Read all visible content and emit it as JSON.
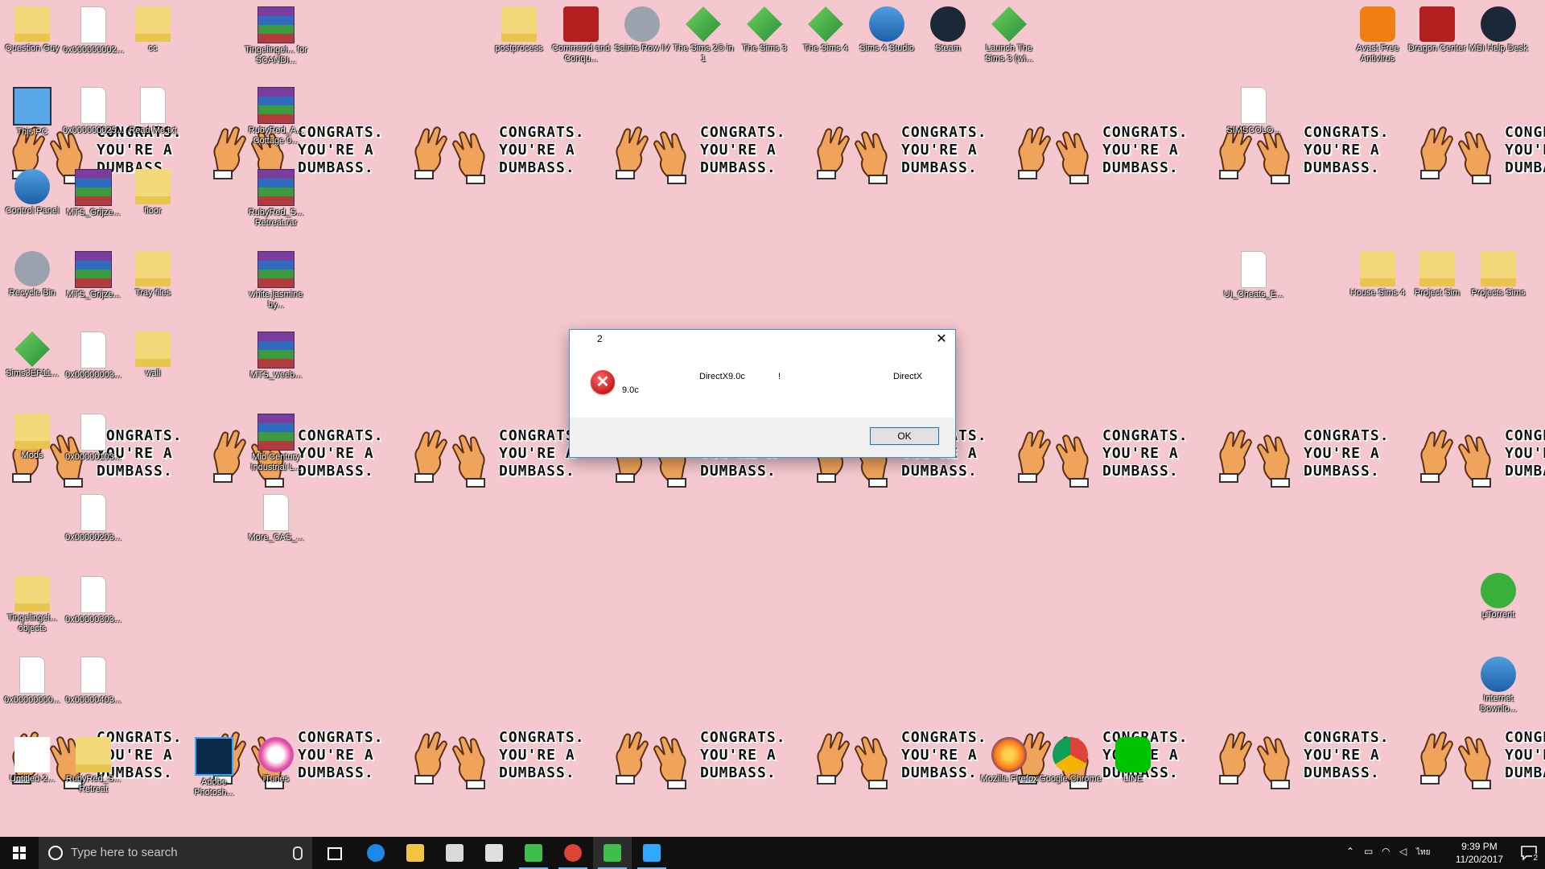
{
  "wallpaper": {
    "tile_text": "CONGRATS.\nYOU'RE A\nDUMBASS.",
    "background": "#f4c8ce"
  },
  "desktop_icons": [
    {
      "label": "Question Guy",
      "icon": "folder-person-icon"
    },
    {
      "label": "0x000000002...",
      "icon": "file-icon"
    },
    {
      "label": "cc",
      "icon": "folder-icon"
    },
    {
      "label": "Tingelingel... for SCANDI...",
      "icon": "winrar-icon"
    },
    {
      "label": "This PC",
      "icon": "pc-icon"
    },
    {
      "label": "0x000000025...",
      "icon": "file-icon"
    },
    {
      "label": "Read Me.txt",
      "icon": "text-file-icon"
    },
    {
      "label": "RubyRed_A... Cottage 0...",
      "icon": "winrar-icon"
    },
    {
      "label": "Control Panel",
      "icon": "control-panel-icon"
    },
    {
      "label": "MTS_Grijze...",
      "icon": "winrar-icon"
    },
    {
      "label": "floor",
      "icon": "folder-icon"
    },
    {
      "label": "RubyRed_S... Retreat.rar",
      "icon": "winrar-icon"
    },
    {
      "label": "Recycle Bin",
      "icon": "recycle-bin-icon"
    },
    {
      "label": "MTS_Grijze...",
      "icon": "winrar-icon"
    },
    {
      "label": "Tray files",
      "icon": "folder-icon"
    },
    {
      "label": "white jasmine by...",
      "icon": "winrar-icon"
    },
    {
      "label": "Sims3EP11...",
      "icon": "sims-icon"
    },
    {
      "label": "0x00000003...",
      "icon": "file-icon"
    },
    {
      "label": "wall",
      "icon": "folder-icon"
    },
    {
      "label": "MTS_weeb...",
      "icon": "winrar-icon"
    },
    {
      "label": "Mods",
      "icon": "folder-icon"
    },
    {
      "label": "0x00000103...",
      "icon": "file-icon"
    },
    {
      "label": "Mid Century Industrial L...",
      "icon": "winrar-icon"
    },
    {
      "label": "0x00000203...",
      "icon": "file-icon"
    },
    {
      "label": "More_CAS_...",
      "icon": "file-icon"
    },
    {
      "label": "Tingelingel... objects",
      "icon": "folder-icon"
    },
    {
      "label": "0x00000303...",
      "icon": "file-icon"
    },
    {
      "label": "0x00000000...",
      "icon": "file-icon"
    },
    {
      "label": "0x00000403...",
      "icon": "file-icon"
    },
    {
      "label": "Untitled-2...",
      "icon": "blank-image-icon"
    },
    {
      "label": "RubyRed_S... Retreat",
      "icon": "folder-icon"
    },
    {
      "label": "Adobe Photosh...",
      "icon": "photoshop-icon"
    },
    {
      "label": "iTunes",
      "icon": "itunes-icon"
    },
    {
      "label": "postprocess",
      "icon": "folder-icon"
    },
    {
      "label": "Command and Conqu...",
      "icon": "command-conquer-icon"
    },
    {
      "label": "Saints Row IV",
      "icon": "saints-row-icon"
    },
    {
      "label": "The Sims 2® in 1",
      "icon": "sims-icon"
    },
    {
      "label": "The Sims 3",
      "icon": "sims-icon"
    },
    {
      "label": "The Sims 4",
      "icon": "sims-icon"
    },
    {
      "label": "Sims 4 Studio",
      "icon": "sims4studio-icon"
    },
    {
      "label": "Steam",
      "icon": "steam-icon"
    },
    {
      "label": "Launch The Sims 3 (wi...",
      "icon": "sims-icon"
    },
    {
      "label": "Avast Free Antivirus",
      "icon": "avast-icon"
    },
    {
      "label": "Dragon Center",
      "icon": "dragon-center-icon"
    },
    {
      "label": "MSI Help Desk",
      "icon": "help-icon"
    },
    {
      "label": "SIMSCOLO...",
      "icon": "file-icon"
    },
    {
      "label": "UI_Cheats_E...",
      "icon": "file-icon"
    },
    {
      "label": "House Sims 4",
      "icon": "folder-icon"
    },
    {
      "label": "Project Sim",
      "icon": "folder-icon"
    },
    {
      "label": "Projects Sims",
      "icon": "folder-icon"
    },
    {
      "label": "µTorrent",
      "icon": "utorrent-icon"
    },
    {
      "label": "Internet Downlo...",
      "icon": "idm-icon"
    },
    {
      "label": "Mozilla Firefox",
      "icon": "firefox-icon"
    },
    {
      "label": "Google Chrome",
      "icon": "chrome-icon"
    },
    {
      "label": "LINE",
      "icon": "line-icon"
    }
  ],
  "dialog": {
    "title": "2",
    "msg_a": "9.0c",
    "msg_b": "DirectX9.0c",
    "msg_c": "!",
    "msg_d": "DirectX",
    "ok_label": "OK",
    "close_glyph": "✕",
    "error_glyph": "✕"
  },
  "taskbar": {
    "search_placeholder": "Type here to search",
    "apps": [
      "edge-icon",
      "file-explorer-icon",
      "store-icon",
      "mail-icon",
      "sims-icon",
      "chrome-icon",
      "sims-icon",
      "photoshop-icon"
    ],
    "time": "9:39 PM",
    "date": "11/20/2017",
    "notification_count": "2",
    "language": "ไทย"
  }
}
